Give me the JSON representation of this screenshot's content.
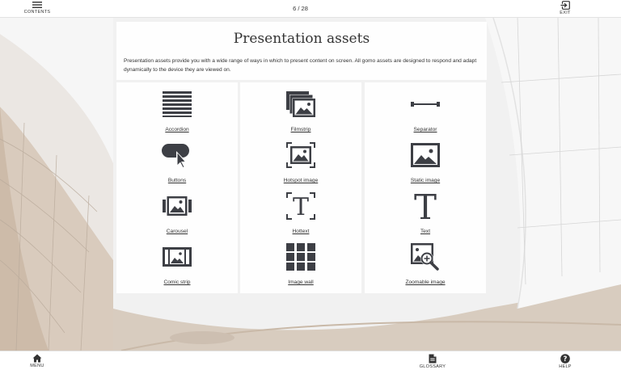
{
  "topbar": {
    "contents_label": "CONTENTS",
    "page_indicator": "6 / 28",
    "exit_label": "EXIT"
  },
  "bottombar": {
    "menu_label": "MENU",
    "glossary_label": "GLOSSARY",
    "help_label": "HELP"
  },
  "main": {
    "title": "Presentation assets",
    "intro": "Presentation assets provide you with a wide range of ways in which to present content on screen.  All gomo assets are designed to respond and adapt dynamically to the device they are viewed on.",
    "columns": [
      [
        {
          "label": "Accordion",
          "icon": "accordion-icon"
        },
        {
          "label": "Buttons",
          "icon": "buttons-icon"
        },
        {
          "label": "Carousel",
          "icon": "carousel-icon"
        },
        {
          "label": "Comic strip",
          "icon": "comic-strip-icon"
        }
      ],
      [
        {
          "label": "Filmstrip",
          "icon": "filmstrip-icon"
        },
        {
          "label": "Hotspot image",
          "icon": "hotspot-image-icon"
        },
        {
          "label": "Hottext",
          "icon": "hottext-icon"
        },
        {
          "label": "Image wall",
          "icon": "image-wall-icon"
        }
      ],
      [
        {
          "label": "Separator",
          "icon": "separator-icon"
        },
        {
          "label": "Static image",
          "icon": "static-image-icon"
        },
        {
          "label": "Text",
          "icon": "text-icon"
        },
        {
          "label": "Zoomable image",
          "icon": "zoomable-image-icon"
        }
      ]
    ]
  },
  "colors": {
    "icon": "#3d3f45",
    "panel": "#ffffff",
    "bar": "#ffffff"
  }
}
